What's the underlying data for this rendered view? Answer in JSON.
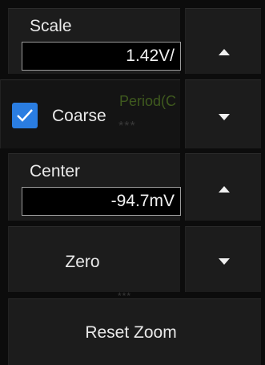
{
  "scale": {
    "label": "Scale",
    "value": "1.42V/"
  },
  "coarse": {
    "label": "Coarse",
    "checked": true
  },
  "center": {
    "label": "Center",
    "value": "-94.7mV"
  },
  "zero": {
    "label": "Zero"
  },
  "reset_zoom": {
    "label": "Reset Zoom"
  },
  "background": {
    "period_text": "Period(C",
    "dots1": "***",
    "dots2": "***"
  },
  "colors": {
    "accent": "#2a7de1",
    "panel": "#1c1c1c",
    "background": "#0b0b0b"
  }
}
